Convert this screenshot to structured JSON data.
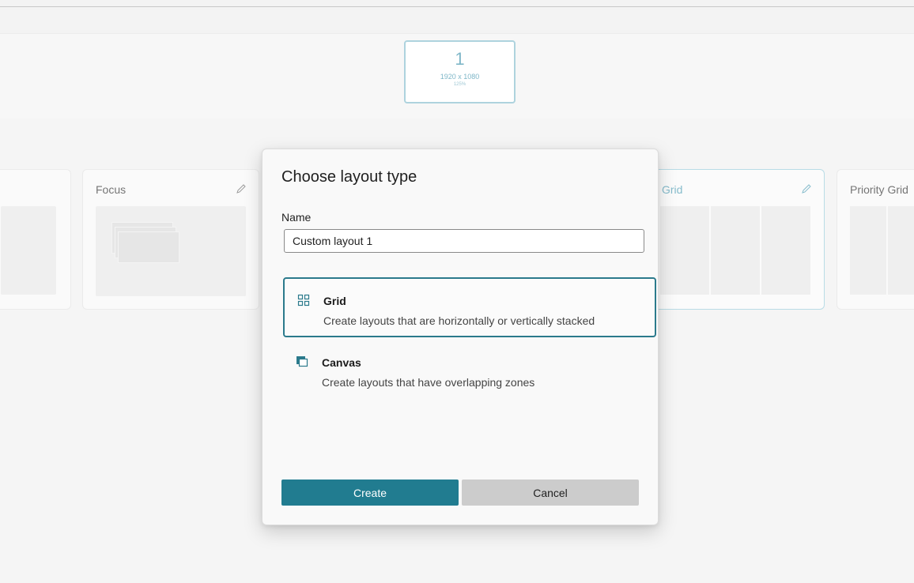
{
  "monitor": {
    "number": "1",
    "resolution": "1920 x 1080",
    "scale": "125%"
  },
  "layouts": {
    "focus": {
      "title": "Focus"
    },
    "grid": {
      "title": "Grid"
    },
    "priority_grid": {
      "title": "Priority Grid"
    }
  },
  "dialog": {
    "title": "Choose layout type",
    "name_label": "Name",
    "name_value": "Custom layout 1",
    "options": [
      {
        "title": "Grid",
        "description": "Create layouts that are horizontally or vertically stacked",
        "icon": "grid-icon",
        "selected": true
      },
      {
        "title": "Canvas",
        "description": "Create layouts that have overlapping zones",
        "icon": "canvas-icon",
        "selected": false
      }
    ],
    "create_label": "Create",
    "cancel_label": "Cancel"
  },
  "colors": {
    "accent": "#217c90",
    "selected_border": "#2b7a8c",
    "monitor_accent": "#7fb7c8"
  }
}
